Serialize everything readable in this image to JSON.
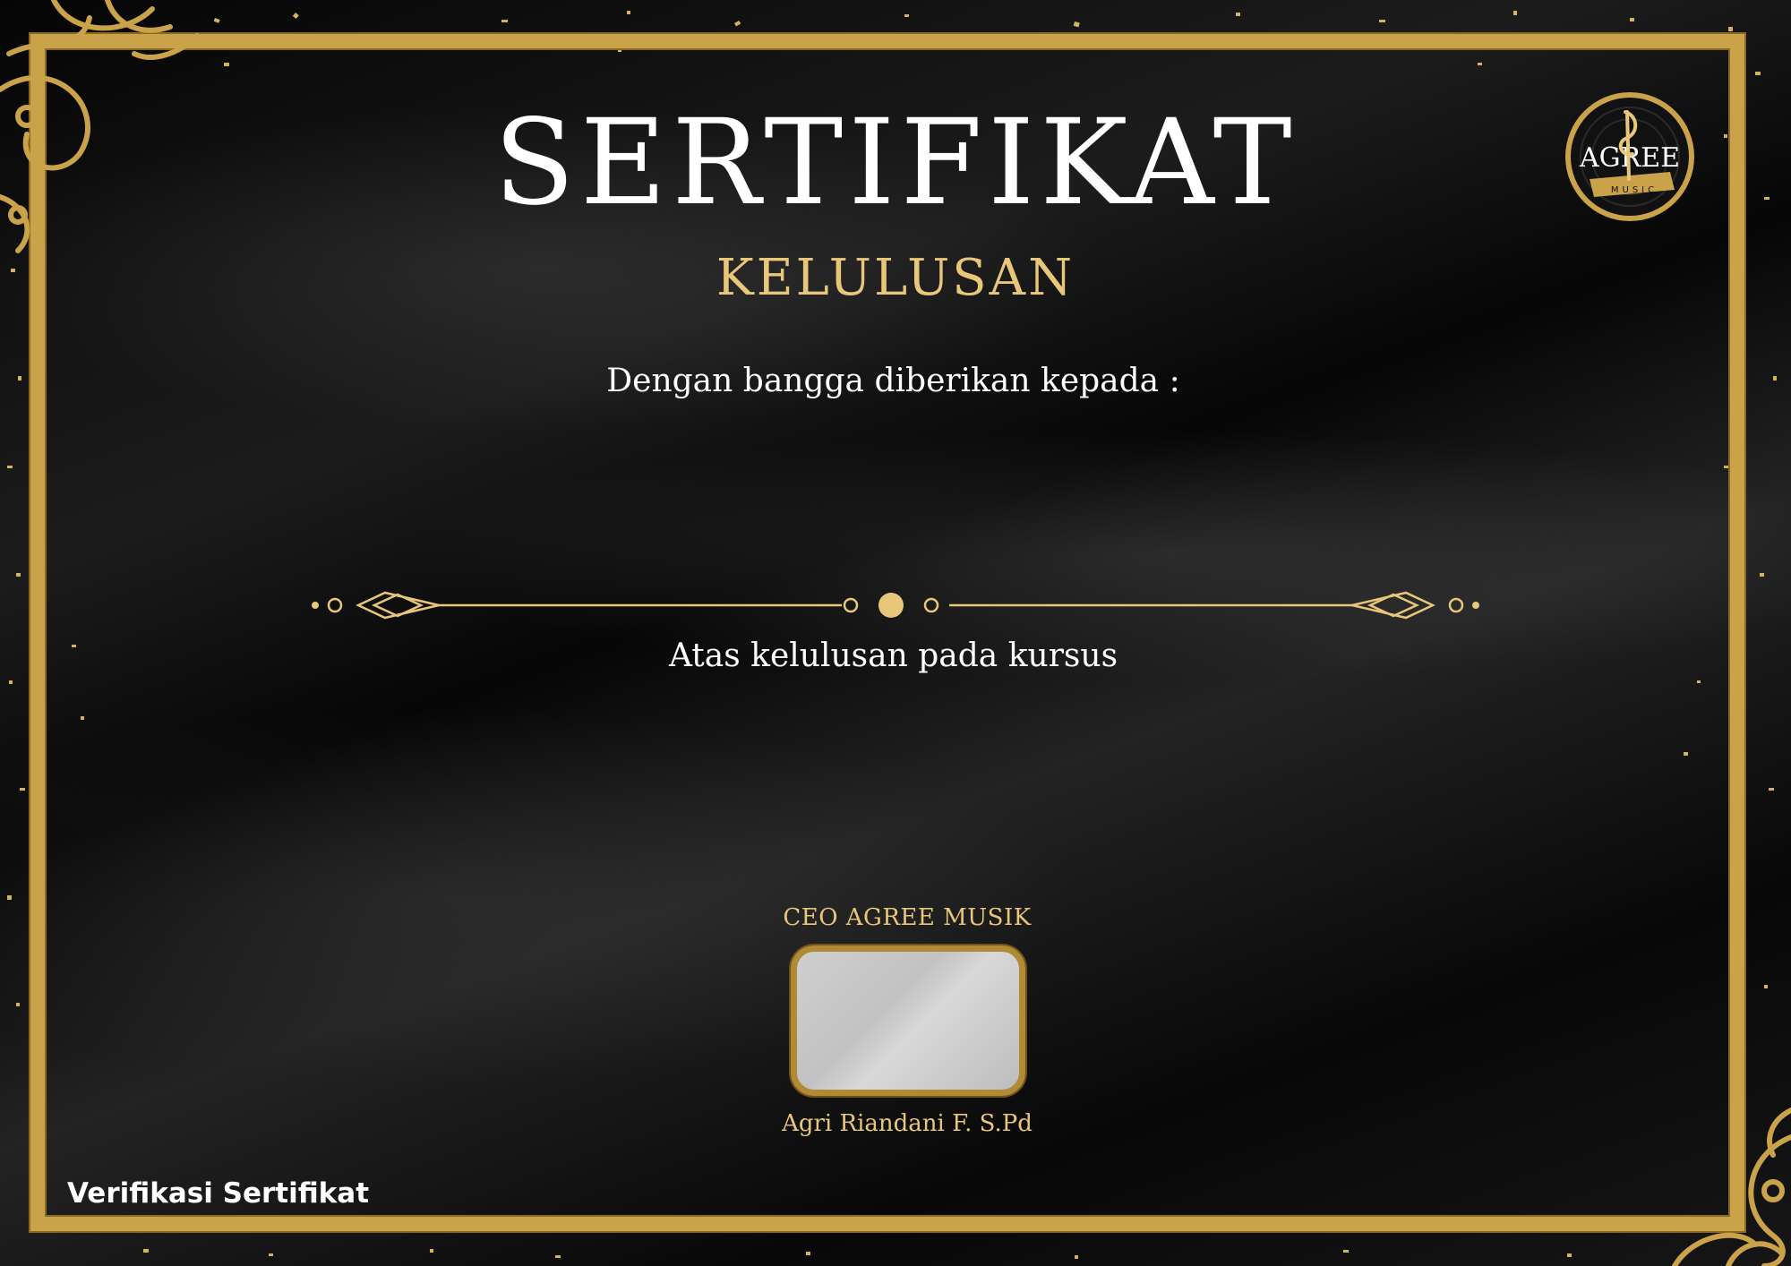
{
  "certificate": {
    "title": "SERTIFIKAT",
    "subtitle": "KELULUSAN",
    "presented_to": "Dengan bangga diberikan kepada :",
    "course_text": "Atas kelulusan pada kursus",
    "signatory_title": "CEO AGREE MUSIK",
    "signatory_name": "Agri Riandani F. S.Pd",
    "verify_link": "Verifikasi Sertifikat"
  },
  "logo": {
    "name": "AGREE",
    "tagline": "MUSIC"
  },
  "colors": {
    "gold": "#c9a24a",
    "gold_light": "#e8c77a",
    "background": "#0a0a0a",
    "text": "#ffffff"
  },
  "icons": [
    "treble-clef-icon",
    "ornament-divider-icon",
    "corner-flourish-icon"
  ]
}
